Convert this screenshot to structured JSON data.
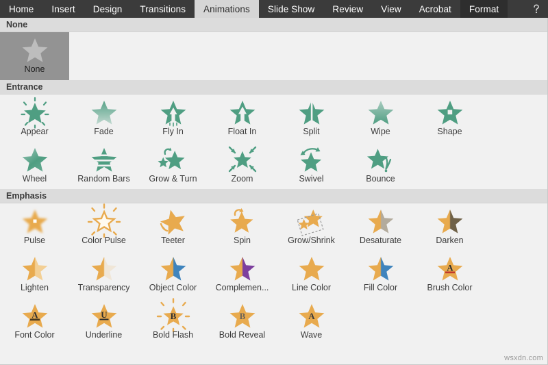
{
  "ribbon": {
    "tabs": [
      {
        "label": "Home",
        "state": "normal"
      },
      {
        "label": "Insert",
        "state": "normal"
      },
      {
        "label": "Design",
        "state": "normal"
      },
      {
        "label": "Transitions",
        "state": "normal"
      },
      {
        "label": "Animations",
        "state": "active"
      },
      {
        "label": "Slide Show",
        "state": "normal"
      },
      {
        "label": "Review",
        "state": "normal"
      },
      {
        "label": "View",
        "state": "normal"
      },
      {
        "label": "Acrobat",
        "state": "normal"
      },
      {
        "label": "Format",
        "state": "contextual"
      }
    ],
    "help_icon": "help-question-icon",
    "colors": {
      "bar_background": "#3b3b3b",
      "active_tab_background": "#d6d6d6",
      "contextual_tab_background": "#2e2e2e",
      "tab_text": "#ffffff"
    }
  },
  "gallery": {
    "background": "#f1f1f1",
    "selected_tile_background": "#939393",
    "section_header_background": "#dcdcdc",
    "entrance_color": "#4f9e82",
    "emphasis_color": "#e8aa4e",
    "sections": [
      {
        "title": "None",
        "items": [
          {
            "label": "None",
            "icon": "star-none-icon",
            "selected": true
          }
        ]
      },
      {
        "title": "Entrance",
        "items": [
          {
            "label": "Appear",
            "icon": "star-burst-icon",
            "selected": false
          },
          {
            "label": "Fade",
            "icon": "star-gradient-icon",
            "selected": false
          },
          {
            "label": "Fly In",
            "icon": "star-arrow-up-icon",
            "selected": false
          },
          {
            "label": "Float In",
            "icon": "star-float-arrow-icon",
            "selected": false
          },
          {
            "label": "Split",
            "icon": "star-split-icon",
            "selected": false
          },
          {
            "label": "Wipe",
            "icon": "star-wipe-icon",
            "selected": false
          },
          {
            "label": "Shape",
            "icon": "star-shape-icon",
            "selected": false
          },
          {
            "label": "Wheel",
            "icon": "star-wheel-icon",
            "selected": false
          },
          {
            "label": "Random Bars",
            "icon": "star-bars-icon",
            "selected": false
          },
          {
            "label": "Grow & Turn",
            "icon": "star-grow-turn-icon",
            "selected": false
          },
          {
            "label": "Zoom",
            "icon": "star-zoom-icon",
            "selected": false
          },
          {
            "label": "Swivel",
            "icon": "star-swivel-icon",
            "selected": false
          },
          {
            "label": "Bounce",
            "icon": "star-bounce-icon",
            "selected": false
          }
        ]
      },
      {
        "title": "Emphasis",
        "items": [
          {
            "label": "Pulse",
            "icon": "star-pulse-icon",
            "selected": false
          },
          {
            "label": "Color Pulse",
            "icon": "star-color-pulse-icon",
            "selected": false
          },
          {
            "label": "Teeter",
            "icon": "star-teeter-icon",
            "selected": false
          },
          {
            "label": "Spin",
            "icon": "star-spin-icon",
            "selected": false
          },
          {
            "label": "Grow/Shrink",
            "icon": "star-grow-shrink-icon",
            "selected": false
          },
          {
            "label": "Desaturate",
            "icon": "star-desaturate-icon",
            "selected": false
          },
          {
            "label": "Darken",
            "icon": "star-darken-icon",
            "selected": false
          },
          {
            "label": "Lighten",
            "icon": "star-lighten-icon",
            "selected": false
          },
          {
            "label": "Transparency",
            "icon": "star-transparency-icon",
            "selected": false
          },
          {
            "label": "Object Color",
            "icon": "star-object-color-icon",
            "selected": false
          },
          {
            "label": "Complemen...",
            "icon": "star-complement-icon",
            "selected": false
          },
          {
            "label": "Line Color",
            "icon": "star-line-color-icon",
            "selected": false
          },
          {
            "label": "Fill Color",
            "icon": "star-fill-color-icon",
            "selected": false
          },
          {
            "label": "Brush Color",
            "icon": "star-brush-color-icon",
            "selected": false
          },
          {
            "label": "Font Color",
            "icon": "star-font-color-icon",
            "selected": false
          },
          {
            "label": "Underline",
            "icon": "star-underline-icon",
            "selected": false
          },
          {
            "label": "Bold Flash",
            "icon": "star-bold-flash-icon",
            "selected": false
          },
          {
            "label": "Bold Reveal",
            "icon": "star-bold-reveal-icon",
            "selected": false
          },
          {
            "label": "Wave",
            "icon": "star-wave-icon",
            "selected": false
          }
        ]
      }
    ]
  },
  "watermark": "wsxdn.com"
}
